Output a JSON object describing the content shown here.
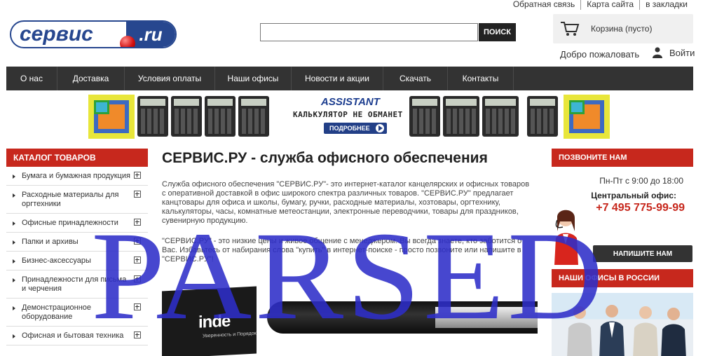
{
  "top_links": [
    "Обратная связь",
    "Карта сайта",
    "в закладки"
  ],
  "logo": {
    "left_text": "сервис",
    "right_text": ".ru"
  },
  "search": {
    "value": "",
    "placeholder": "",
    "button": "ПОИСК"
  },
  "cart": {
    "label": "Корзина (пусто)",
    "icon": "cart-icon"
  },
  "account": {
    "welcome": "Добро пожаловать",
    "login": "Войти",
    "icon": "user-icon"
  },
  "nav": [
    "О нас",
    "Доставка",
    "Условия оплаты",
    "Наши офисы",
    "Новости и акции",
    "Скачать",
    "Контакты"
  ],
  "banner": {
    "brand": "ASSISTANT",
    "slogan": "КАЛЬКУЛЯТОР НЕ ОБМАНЕТ",
    "button": "ПОДРОБНЕЕ"
  },
  "catalog": {
    "title": "КАТАЛОГ ТОВАРОВ",
    "items": [
      "Бумага и бумажная продукция",
      "Расходные материалы для оргтехники",
      "Офисные принадлежности",
      "Папки и архивы",
      "Бизнес-аксессуары",
      "Принадлежности для письма и черчения",
      "Демонстрационное оборудование",
      "Офисная и бытовая техника"
    ]
  },
  "main": {
    "title": "СЕРВИС.РУ - служба офисного обеспечения",
    "p1": "Служба офисного обеспечения \"СЕРВИС.РУ\"- это интернет-каталог канцелярских и офисных товаров с оперативной доставкой в офис широкого спектра различных товаров. \"СЕРВИС.РУ\" предлагает канцтовары для офиса и школы, бумагу, ручки, расходные материалы, хозтовары, оргтехнику, калькуляторы, часы, комнатные метеостанции, электронные переводчики, товары для праздников, сувенирную продукцию.",
    "p2": "\"СЕРВИС.РУ\" - это низкие цены и живое общение с менеджером. Вы всегда знаете, кто заботится о Вас. Избавьтесь от набирания слова \"купить\" в интернет-поиске - просто позвоните или напишите в \"СЕРВИС.РУ\"!",
    "photo": {
      "brand": "inde",
      "tagline": "Уверенность и Порядок"
    }
  },
  "call": {
    "title": "ПОЗВОНИТЕ НАМ",
    "hours": "Пн-Пт с 9:00 до 18:00",
    "office_label": "Центральный офис:",
    "phone": "+7 495 775-99-99",
    "button": "НАПИШИТЕ НАМ"
  },
  "offices": {
    "title": "НАШИ ОФИСЫ В РОССИИ"
  },
  "watermark": "PARSED"
}
